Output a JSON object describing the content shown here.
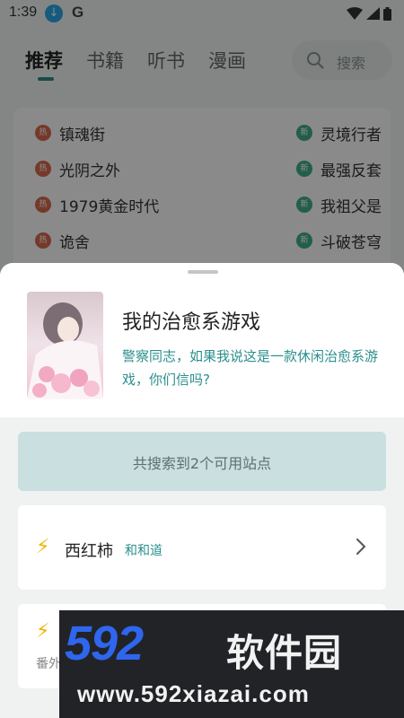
{
  "status_bar": {
    "time": "1:39",
    "g_label": "G"
  },
  "tabs": [
    {
      "label": "推荐",
      "active": true
    },
    {
      "label": "书籍",
      "active": false
    },
    {
      "label": "听书",
      "active": false
    },
    {
      "label": "漫画",
      "active": false
    }
  ],
  "search": {
    "placeholder": "搜索"
  },
  "rankings": {
    "left": [
      {
        "badge": "热",
        "title": "镇魂街"
      },
      {
        "badge": "热",
        "title": "光阴之外"
      },
      {
        "badge": "热",
        "title": "1979黄金时代"
      },
      {
        "badge": "热",
        "title": "诡舍"
      }
    ],
    "right": [
      {
        "badge": "新",
        "title": "灵境行者"
      },
      {
        "badge": "新",
        "title": "最强反套"
      },
      {
        "badge": "新",
        "title": "我祖父是"
      },
      {
        "badge": "新",
        "title": "斗破苍穹"
      }
    ]
  },
  "book": {
    "title": "我的治愈系游戏",
    "description": "警察同志，如果我说这是一款休闲治愈系游戏，你们信吗?"
  },
  "result_banner": "共搜索到2个可用站点",
  "sites": [
    {
      "name": "西红柿",
      "author": "和和道",
      "sub": ""
    },
    {
      "name": "",
      "author": "",
      "sub": "番外"
    }
  ],
  "watermark": {
    "logo": "592",
    "name": "软件园",
    "url": "www.592xiazai.com"
  },
  "colors": {
    "accent": "#2a8f8c",
    "bolt": "#f0b400",
    "hot_badge": "#d86a4e",
    "new_badge": "#3fae8c"
  }
}
